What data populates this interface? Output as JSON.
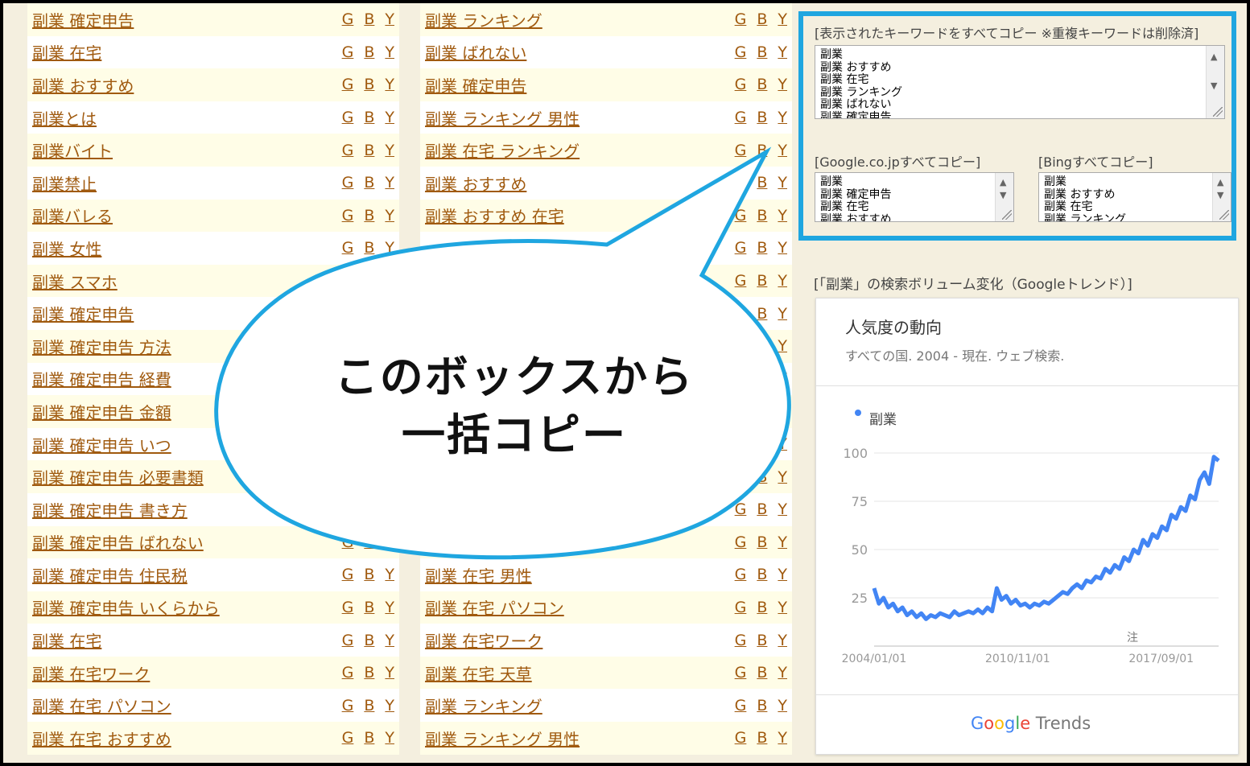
{
  "keyword_columns": {
    "left": [
      "副業 確定申告",
      "副業 在宅",
      "副業 おすすめ",
      "副業とは",
      "副業バイト",
      "副業禁止",
      "副業バレる",
      "副業 女性",
      "副業 スマホ",
      "副業 確定申告",
      "副業 確定申告 方法",
      "副業 確定申告 経費",
      "副業 確定申告 金額",
      "副業 確定申告 いつ",
      "副業 確定申告 必要書類",
      "副業 確定申告 書き方",
      "副業 確定申告 ばれない",
      "副業 確定申告 住民税",
      "副業 確定申告 いくらから",
      "副業 在宅",
      "副業 在宅ワーク",
      "副業 在宅 パソコン",
      "副業 在宅 おすすめ"
    ],
    "mid": [
      "副業 ランキング",
      "副業 ばれない",
      "副業 確定申告",
      "副業 ランキング 男性",
      "副業 在宅 ランキング",
      "副業 おすすめ",
      "副業 おすすめ 在宅",
      "",
      "",
      "",
      "",
      "",
      "",
      "",
      "",
      "",
      "",
      "副業 在宅 男性",
      "副業 在宅 パソコン",
      "副業 在宅ワーク",
      "副業 在宅 天草",
      "副業 ランキング",
      "副業 ランキング 男性"
    ]
  },
  "gby": {
    "g": "G",
    "b": "B",
    "y": "Y"
  },
  "copy_panel": {
    "all_label": "[表示されたキーワードをすべてコピー ※重複キーワードは削除済]",
    "all_lines": [
      "副業",
      "副業 おすすめ",
      "副業 在宅",
      "副業 ランキング",
      "副業 ばれない",
      "副業 確定申告"
    ],
    "google_label": "[Google.co.jpすべてコピー]",
    "google_lines": [
      "副業",
      "副業 確定申告",
      "副業 在宅",
      "副業 おすすめ"
    ],
    "bing_label": "[Bingすべてコピー]",
    "bing_lines": [
      "副業",
      "副業 おすすめ",
      "副業 在宅",
      "副業 ランキング"
    ],
    "accent": "#1fa6e0"
  },
  "trends": {
    "heading": "[「副業」の検索ボリューム変化（Googleトレンド）]",
    "title": "人気度の動向",
    "subtitle": "すべての国. 2004 - 現在. ウェブ検索.",
    "logo_google": [
      "G",
      "o",
      "o",
      "g",
      "l",
      "e"
    ],
    "logo_trends": " Trends",
    "note_marker": "注"
  },
  "chart_data": {
    "type": "line",
    "title": "人気度の動向",
    "x_ticks": [
      "2004/01/01",
      "2010/11/01",
      "2017/09/01"
    ],
    "y_ticks": [
      25,
      50,
      75,
      100
    ],
    "ylim": [
      0,
      100
    ],
    "series": [
      {
        "name": "副業",
        "color": "#4285f4",
        "values": [
          30,
          22,
          25,
          20,
          22,
          18,
          20,
          16,
          18,
          15,
          17,
          14,
          16,
          15,
          17,
          16,
          15,
          18,
          16,
          17,
          18,
          17,
          19,
          17,
          20,
          18,
          30,
          24,
          26,
          22,
          24,
          21,
          22,
          20,
          22,
          21,
          23,
          22,
          24,
          26,
          28,
          27,
          30,
          32,
          30,
          34,
          33,
          36,
          35,
          40,
          38,
          42,
          40,
          46,
          44,
          50,
          48,
          55,
          52,
          58,
          56,
          62,
          60,
          68,
          66,
          72,
          70,
          78,
          76,
          86,
          90,
          84,
          98,
          96
        ]
      }
    ],
    "legend": "top-left",
    "grid": true
  },
  "callout": {
    "line1": "このボックスから",
    "line2": "一括コピー",
    "stroke": "#1fa6e0"
  }
}
